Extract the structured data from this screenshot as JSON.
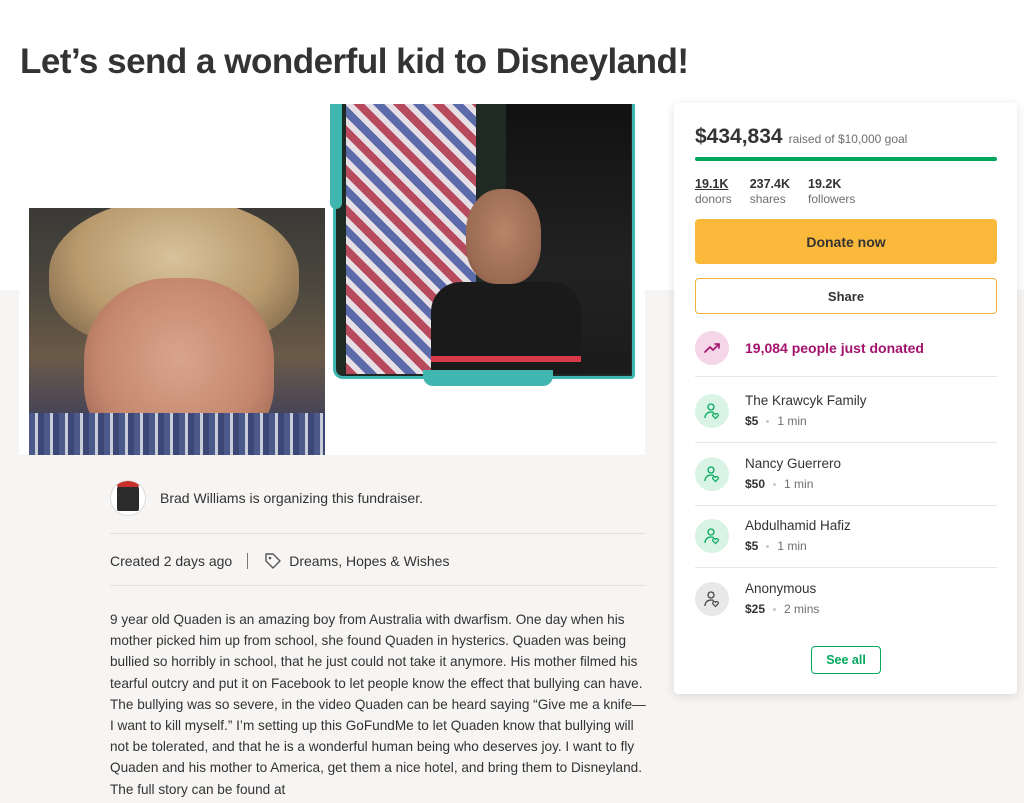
{
  "page": {
    "title": "Let’s send a wonderful kid to Disneyland!"
  },
  "organizer": {
    "text": "Brad Williams is organizing this fundraiser."
  },
  "meta": {
    "created": "Created 2 days ago",
    "category": "Dreams, Hopes & Wishes"
  },
  "story": {
    "text": "9 year old Quaden is an amazing boy from Australia with dwarfism. One day when his mother picked him up from school, she found Quaden in hysterics. Quaden was being bullied so horribly in school, that he just could not take it anymore. His mother filmed his tearful outcry and put it on Facebook to let people know the effect that bullying can have. The bullying was so severe, in the video Quaden can be heard saying “Give me a knife—I want to kill myself.” I’m setting up this GoFundMe to let Quaden know that bullying will not be tolerated, and that he is a wonderful human being who deserves joy. I want to fly Quaden and his mother to America, get them a nice hotel, and bring them to Disneyland. The full story can be found at"
  },
  "sidebar": {
    "amount": "$434,834",
    "goal_text": "raised of $10,000 goal",
    "progress_fraction": 1.0,
    "stats": [
      {
        "value": "19.1K",
        "label": "donors"
      },
      {
        "value": "237.4K",
        "label": "shares"
      },
      {
        "value": "19.2K",
        "label": "followers"
      }
    ],
    "donate_label": "Donate now",
    "share_label": "Share",
    "trend_text": "19,084 people just donated",
    "donations": [
      {
        "name": "The Krawcyk Family",
        "amount": "$5",
        "time": "1 min"
      },
      {
        "name": "Nancy Guerrero",
        "amount": "$50",
        "time": "1 min"
      },
      {
        "name": "Abdulhamid Hafiz",
        "amount": "$5",
        "time": "1 min"
      },
      {
        "name": "Anonymous",
        "amount": "$25",
        "time": "2 mins"
      }
    ],
    "see_all_label": "See all"
  },
  "colors": {
    "accent_green": "#02a95c",
    "donate_yellow": "#fbb93b",
    "trend_magenta": "#a4126e"
  }
}
